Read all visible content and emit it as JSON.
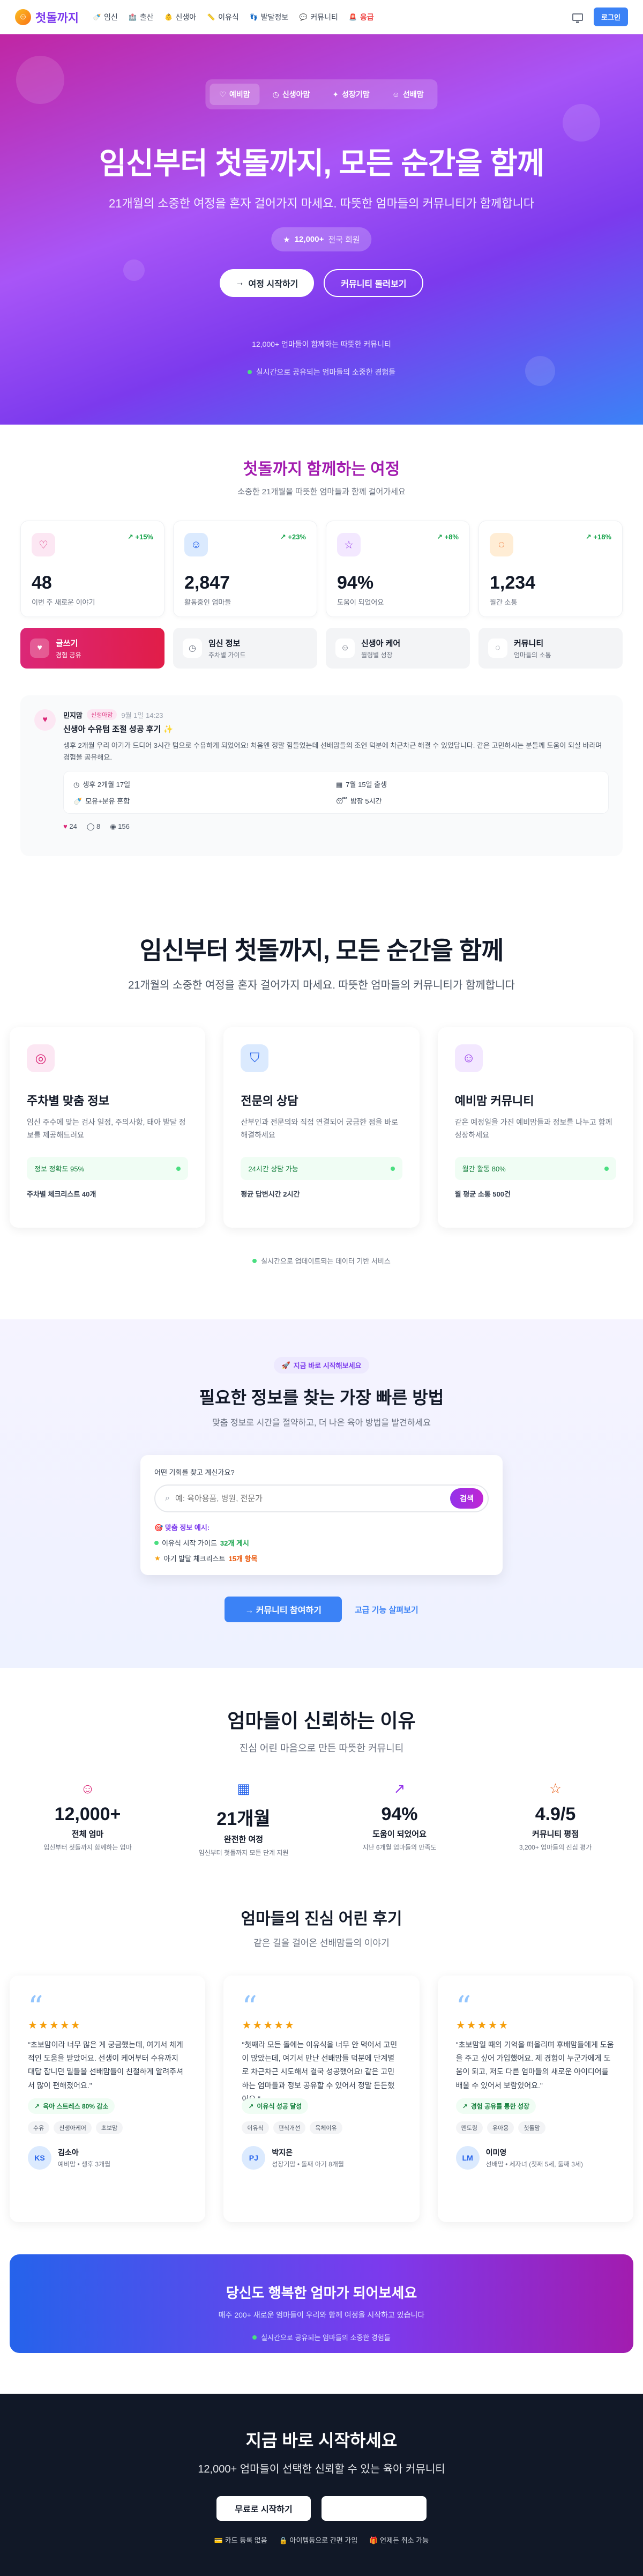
{
  "header": {
    "logo": "첫돌까지",
    "nav": [
      {
        "icon": "baby-bottle-icon",
        "glyph": "🍼",
        "label": "임신"
      },
      {
        "icon": "hospital-icon",
        "glyph": "🏥",
        "label": "출산"
      },
      {
        "icon": "newborn-icon",
        "glyph": "👶",
        "label": "신생아"
      },
      {
        "icon": "ruler-icon",
        "glyph": "📏",
        "label": "이유식"
      },
      {
        "icon": "footprint-icon",
        "glyph": "👣",
        "label": "발달정보"
      },
      {
        "icon": "chat-icon",
        "glyph": "💬",
        "label": "커뮤니티"
      },
      {
        "icon": "siren-icon",
        "glyph": "🚨",
        "label": "응급"
      }
    ],
    "login": "로그인"
  },
  "hero": {
    "tabs": [
      {
        "icon": "heart-icon",
        "glyph": "♡",
        "label": "예비맘"
      },
      {
        "icon": "clock-icon",
        "glyph": "◷",
        "label": "신생아맘"
      },
      {
        "icon": "sparkle-icon",
        "glyph": "✦",
        "label": "성장기맘"
      },
      {
        "icon": "users-icon",
        "glyph": "☺",
        "label": "선배맘"
      }
    ],
    "title": "임신부터 첫돌까지, 모든 순간을 함께",
    "subtitle": "21개월의 소중한 여정을 혼자 걸어가지 마세요. 따뜻한 엄마들의 커뮤니티가 함께합니다",
    "badge_count": "12,000+",
    "badge_text": "전국 회원",
    "cta_primary": "여정 시작하기",
    "cta_secondary": "커뮤니티 둘러보기",
    "note1": "12,000+ 엄마들이 함께하는 따뜻한 커뮤니티",
    "note2": "실시간으로 공유되는 엄마들의 소중한 경험들"
  },
  "journey": {
    "title": "첫돌까지 함께하는 여정",
    "subtitle": "소중한 21개월을 따뜻한 엄마들과 함께 걸어가세요",
    "stats": [
      {
        "icon": "heart-icon",
        "glyph": "♡",
        "color": "#db2777",
        "bg": "#fce7f3",
        "delta": "+15%",
        "value": "48",
        "label": "이번 주 새로운 이야기"
      },
      {
        "icon": "users-icon",
        "glyph": "☺",
        "color": "#2563eb",
        "bg": "#dbeafe",
        "delta": "+23%",
        "value": "2,847",
        "label": "활동중인 엄마들"
      },
      {
        "icon": "star-icon",
        "glyph": "☆",
        "color": "#9333ea",
        "bg": "#f3e8ff",
        "delta": "+8%",
        "value": "94%",
        "label": "도움이 되었어요"
      },
      {
        "icon": "message-icon",
        "glyph": "◌",
        "color": "#ea580c",
        "bg": "#ffedd5",
        "delta": "+18%",
        "value": "1,234",
        "label": "월간 소통"
      }
    ],
    "tabs": [
      {
        "icon": "heart-icon",
        "glyph": "♥",
        "title": "글쓰기",
        "sub": "경험 공유"
      },
      {
        "icon": "clock-icon",
        "glyph": "◷",
        "title": "임신 정보",
        "sub": "주차별 가이드"
      },
      {
        "icon": "users-icon",
        "glyph": "☺",
        "title": "신생아 케어",
        "sub": "월령별 성장"
      },
      {
        "icon": "message-icon",
        "glyph": "◌",
        "title": "커뮤니티",
        "sub": "엄마들의 소통"
      }
    ],
    "post": {
      "author": "민지맘",
      "tag": "신생아맘",
      "time": "9월 1일 14:23",
      "title": "신생아 수유텀 조절 성공 후기 ✨",
      "body": "생후 2개월 우리 아기가 드디어 3시간 텀으로 수유하게 되었어요! 처음엔 정말 힘들었는데 선배맘들의 조언 덕분에 차근차근 해결 수 있었답니다. 같은 고민하시는 분들께 도움이 되실 바라며 경험을 공유해요.",
      "info": [
        {
          "icon": "clock-icon",
          "glyph": "◷",
          "text": "생후 2개월 17일"
        },
        {
          "icon": "calendar-icon",
          "glyph": "▦",
          "text": "7월 15일 출생"
        },
        {
          "icon": "bottle-icon",
          "glyph": "🍼",
          "text": "모유+분유 혼합"
        },
        {
          "icon": "sleep-icon",
          "glyph": "😴",
          "text": "밤잠 5시간"
        }
      ],
      "likes": "24",
      "comments": "8",
      "views": "156"
    }
  },
  "features": {
    "title": "임신부터 첫돌까지, 모든 순간을 함께",
    "subtitle": "21개월의 소중한 여정을 혼자 걸어가지 마세요. 따뜻한 엄마들의 커뮤니티가 함께합니다",
    "cards": [
      {
        "icon": "target-icon",
        "glyph": "◎",
        "color": "#db2777",
        "bg": "#fce7f3",
        "title": "주차별 맞춤 정보",
        "desc": "임신 주수에 맞는 검사 일정, 주의사항, 태아 발달 정보를 제공해드려요",
        "stat": "정보 정확도 95%",
        "foot": "주차별 체크리스트 40개"
      },
      {
        "icon": "shield-icon",
        "glyph": "⛉",
        "color": "#2563eb",
        "bg": "#dbeafe",
        "title": "전문의 상담",
        "desc": "산부인과 전문의와 직접 연결되어 궁금한 점을 바로 해결하세요",
        "stat": "24시간 상담 가능",
        "foot": "평균 답변시간 2시간"
      },
      {
        "icon": "users-icon",
        "glyph": "☺",
        "color": "#9333ea",
        "bg": "#f3e8ff",
        "title": "예비맘 커뮤니티",
        "desc": "같은 예정일을 가진 예비맘들과 정보를 나누고 함께 성장하세요",
        "stat": "월간 활동 80%",
        "foot": "월 평균 소통 500건"
      }
    ],
    "note": "실시간으로 업데이트되는 데이터 기반 서비스"
  },
  "search": {
    "label": "지금 바로 시작해보세요",
    "title": "필요한 정보를 찾는 가장 빠른 방법",
    "subtitle": "맞춤 정보로 시간을 절약하고, 더 나은 육아 방법을 발견하세요",
    "question": "어떤 기회를 찾고 계신가요?",
    "placeholder": "예: 육아용품, 병원, 전문가",
    "button": "검색",
    "hint_title": "맞춤 정보 예시:",
    "hint1_pre": "이유식 시작 가이드",
    "hint1_hl": "32개 게시",
    "hint2_pre": "아기 발달 체크리스트",
    "hint2_hl": "15개 항목",
    "cta_primary": "커뮤니티 참여하기",
    "cta_secondary": "고급 기능 살펴보기"
  },
  "trust": {
    "title": "엄마들이 신뢰하는 이유",
    "subtitle": "진심 어린 마음으로 만든 따뜻한 커뮤니티",
    "stats": [
      {
        "icon": "users-icon",
        "glyph": "☺",
        "color": "#db2777",
        "value": "12,000+",
        "label": "전체 엄마",
        "sub": "임신부터 첫돌까지 함께하는 엄마"
      },
      {
        "icon": "calendar-icon",
        "glyph": "▦",
        "color": "#2563eb",
        "value": "21개월",
        "label": "완전한 여정",
        "sub": "임신부터 첫돌까지 모든 단계 지원"
      },
      {
        "icon": "trend-up-icon",
        "glyph": "↗",
        "color": "#9333ea",
        "value": "94%",
        "label": "도움이 되었어요",
        "sub": "지난 6개월 엄마들의 만족도"
      },
      {
        "icon": "star-icon",
        "glyph": "☆",
        "color": "#ea580c",
        "value": "4.9/5",
        "label": "커뮤니티 평점",
        "sub": "3,200+ 엄마들의 진심 평가"
      }
    ],
    "reviews_title": "엄마들의 진심 어린 후기",
    "reviews_sub": "같은 길을 걸어온 선배맘들의 이야기",
    "reviews": [
      {
        "stars": "★★★★★",
        "text": "\"초보맘이라 너무 많은 게 궁금했는데, 여기서 체계적인 도움을 받았어요. 선생이 케어부터 수유까지 대답 잡니던 밀들을 선배맘들이 친절하게 알려주셔서 많이 편해졌어요.\"",
        "badge": "육아 스트레스 80% 감소",
        "tags": [
          "수유",
          "신생아케어",
          "초보맘"
        ],
        "initials": "KS",
        "avatar_bg": "#dbeafe",
        "avatar_fg": "#2563eb",
        "name": "김소아",
        "meta": "예비맘 • 생후 3개월"
      },
      {
        "stars": "★★★★★",
        "text": "\"첫째라 모든 돌에는 이유식을 너무 안 먹어서 고민이 많았는데, 여기서 만난 선배맘들 덕분에 단계별로 차근차근 시도해서 결국 성공했어요! 같은 고민하는 엄마들과 정보 공유할 수 있어서 정말 든든했어요.\"",
        "badge": "이유식 성공 달성",
        "tags": [
          "이유식",
          "편식개선",
          "육체이유"
        ],
        "initials": "PJ",
        "avatar_bg": "#dbeafe",
        "avatar_fg": "#2563eb",
        "name": "박지은",
        "meta": "성장기맘 • 돌째 아기 8개월"
      },
      {
        "stars": "★★★★★",
        "text": "\"초보맘일 때의 기억을 떠올리며 후배맘들에게 도움을 주고 싶어 가입했어요. 제 경험이 누군가에게 도움이 되고, 저도 다른 엄마들의 새로운 아이디어를 배울 수 있어서 보람있어요.\"",
        "badge": "경험 공유를 통한 성장",
        "tags": [
          "멘토링",
          "유아용",
          "첫돌맘"
        ],
        "initials": "LM",
        "avatar_bg": "#dbeafe",
        "avatar_fg": "#2563eb",
        "name": "이미영",
        "meta": "선배맘 • 세자녀 (첫째 5세, 둘째 3세)"
      }
    ]
  },
  "banner": {
    "title": "당신도 행복한 엄마가 되어보세요",
    "subtitle": "매주 200+ 새로운 엄마들이 우리와 함께 여정을 시작하고 있습니다",
    "note": "실시간으로 공유되는 엄마들의 소중한 경험들"
  },
  "footer": {
    "title": "지금 바로 시작하세요",
    "subtitle": "12,000+ 엄마들이 선택한 신뢰할 수 있는 육아 커뮤니티",
    "cta": "무료로 시작하기",
    "trust": [
      {
        "glyph": "💳",
        "text": "카드 등록 없음"
      },
      {
        "glyph": "🔒",
        "text": "아이템등으로 간편 가입"
      },
      {
        "glyph": "🎁",
        "text": "언제든 취소 가능"
      }
    ],
    "trust_join": "카드 등록 없음 · 아이템등으로 간편 가입 · 🎁 언제든 취소 가능"
  }
}
